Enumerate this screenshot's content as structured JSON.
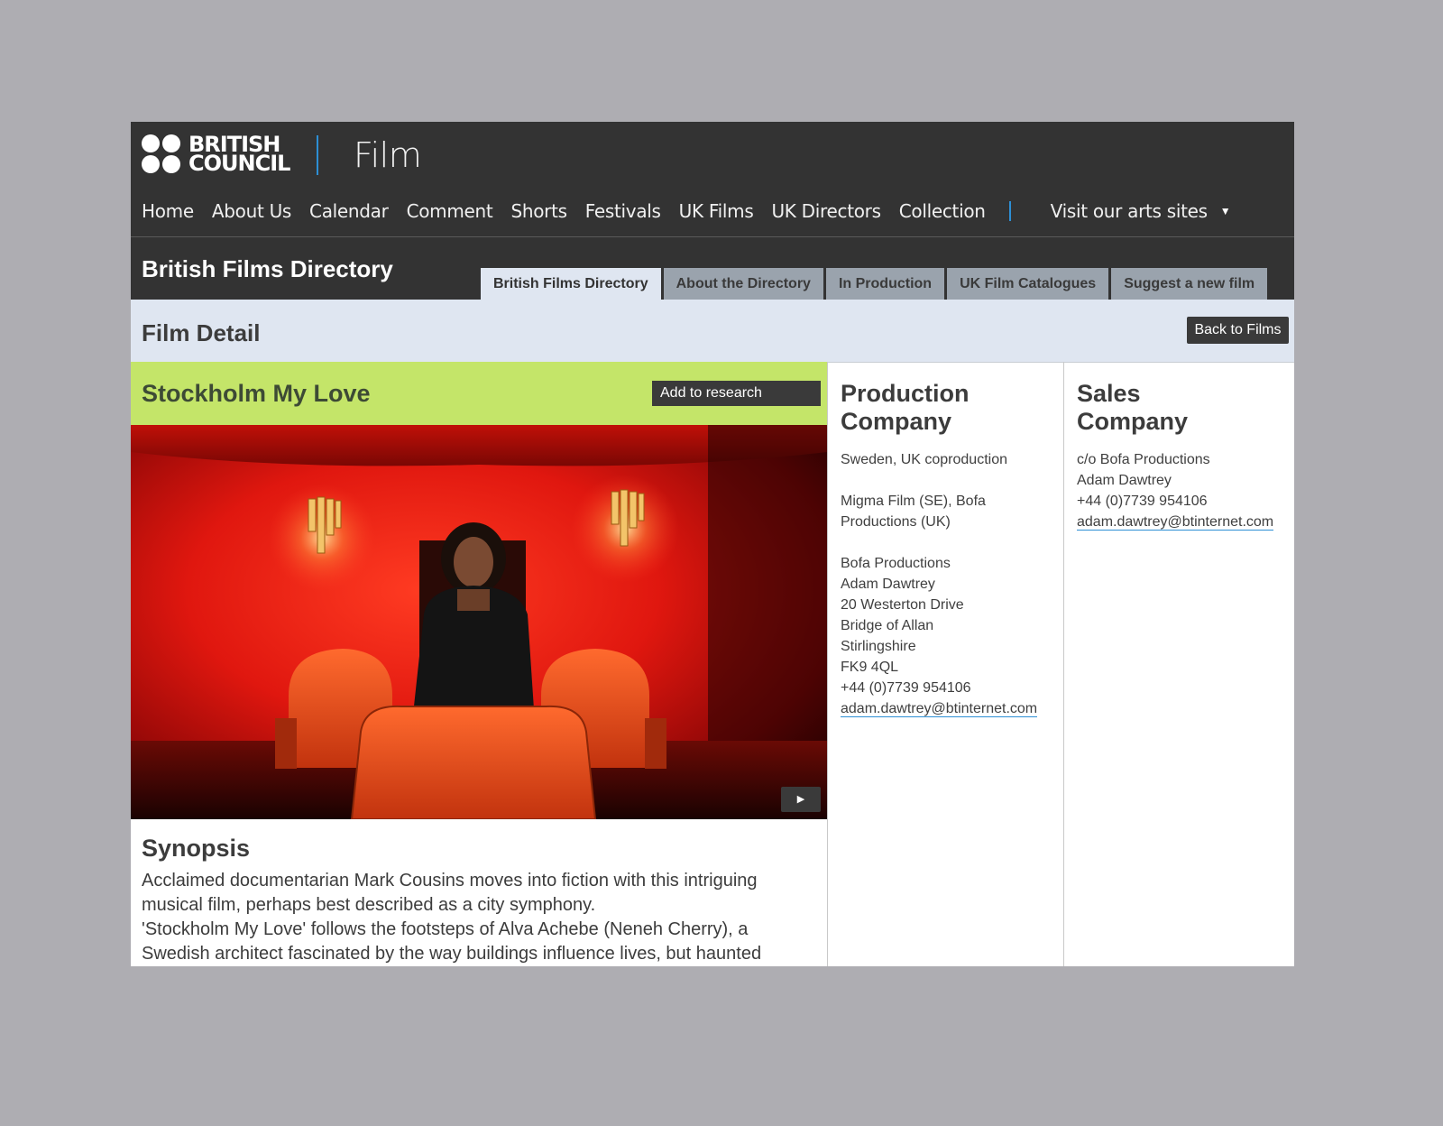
{
  "header": {
    "logo_text": "BRITISH\nCOUNCIL",
    "site_title": "Film",
    "nav": [
      "Home",
      "About Us",
      "Calendar",
      "Comment",
      "Shorts",
      "Festivals",
      "UK Films",
      "UK Directors",
      "Collection"
    ],
    "arts_label": "Visit our arts sites"
  },
  "directory": {
    "title": "British Films Directory",
    "tabs": [
      "British Films Directory",
      "About the Directory",
      "In Production",
      "UK Film Catalogues",
      "Suggest a new film"
    ],
    "active_tab": 0
  },
  "detail": {
    "title": "Film Detail",
    "back_label": "Back to Films"
  },
  "film": {
    "title": "Stockholm My Love",
    "research_label": "Add to research",
    "synopsis_heading": "Synopsis",
    "synopsis_lines": [
      "Acclaimed documentarian Mark Cousins moves into fiction with this intriguing",
      "musical film, perhaps best described as a city symphony.",
      "'Stockholm My Love' follows the footsteps of Alva Achebe (Neneh Cherry), a",
      "Swedish architect fascinated by the way buildings influence lives, but haunted"
    ]
  },
  "production": {
    "heading": "Production\nCompany",
    "origin": "Sweden, UK coproduction",
    "companies": [
      "Migma Film (SE), Bofa",
      "Productions (UK)"
    ],
    "contact": [
      "Bofa Productions",
      "Adam Dawtrey",
      "20 Westerton Drive",
      "Bridge of Allan",
      "Stirlingshire",
      "FK9 4QL",
      "+44 (0)7739 954106"
    ],
    "email": "adam.dawtrey@btinternet.com"
  },
  "sales": {
    "heading": "Sales\nCompany",
    "contact": [
      "c/o Bofa Productions",
      "Adam Dawtrey",
      "+44 (0)7739 954106"
    ],
    "email": "adam.dawtrey@btinternet.com"
  },
  "colors": {
    "header_bg": "#333333",
    "accent_blue": "#2d8fd5",
    "detail_bar": "#dfe6f1",
    "film_header_green": "#c4e569",
    "tab_inactive": "#9aa3ad"
  },
  "icons": [
    "british-council-logo",
    "dropdown-caret-icon",
    "play-icon"
  ]
}
